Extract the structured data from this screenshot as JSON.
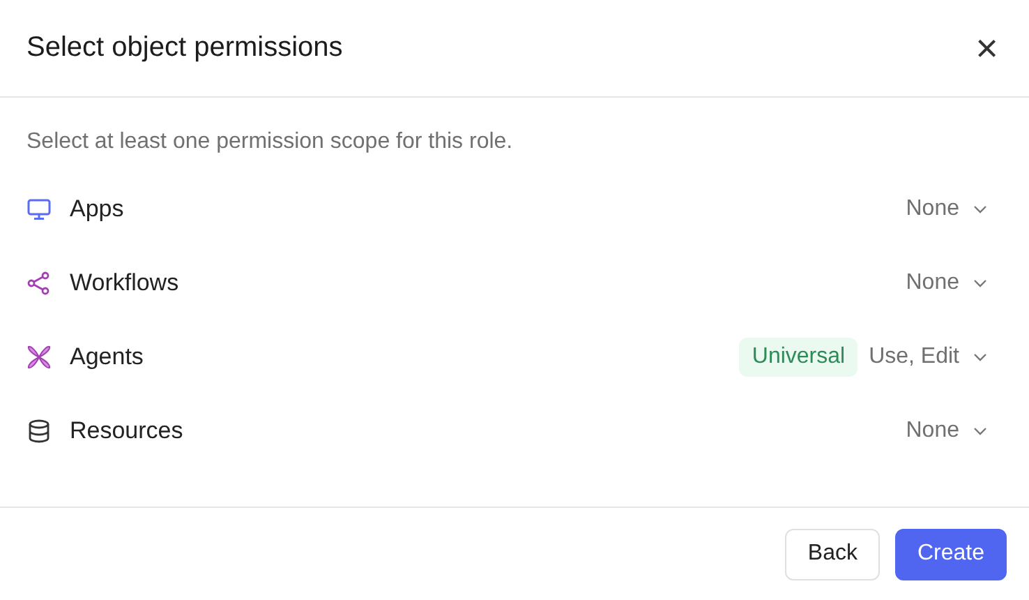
{
  "dialog": {
    "title": "Select object permissions",
    "close": "×"
  },
  "instructions": "Select at least one permission scope for this role.",
  "permissions": [
    {
      "kind": "apps",
      "label": "Apps",
      "value": "None"
    },
    {
      "kind": "workflows",
      "label": "Workflows",
      "value": "None"
    },
    {
      "kind": "agents",
      "label": "Agents",
      "badge": "Universal",
      "value": "Use, Edit"
    },
    {
      "kind": "resources",
      "label": "Resources",
      "value": "None"
    }
  ],
  "buttons": [
    {
      "kind": "secondary",
      "label": "Back"
    },
    {
      "kind": "primary",
      "label": "Create"
    }
  ]
}
